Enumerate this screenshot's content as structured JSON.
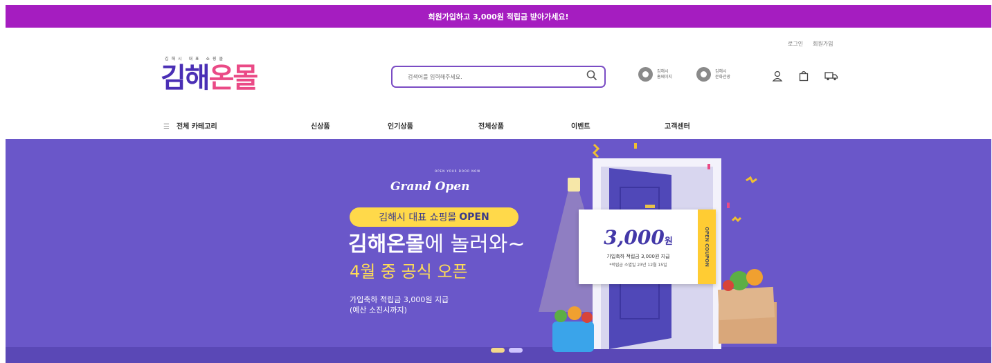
{
  "topbar": {
    "text": "회원가입하고 3,000원 적립금 받아가세요!"
  },
  "util": {
    "login": "로그인",
    "signup": "회원가입"
  },
  "logo": {
    "sub": "김해시 대표 쇼핑몰",
    "main_a": "김해",
    "main_b": "온몰"
  },
  "search": {
    "placeholder": "검색어를 입력해주세요."
  },
  "ext_links": [
    {
      "line1": "김해시",
      "line2": "홈페이지"
    },
    {
      "line1": "김해시",
      "line2": "문화관광"
    }
  ],
  "nav": {
    "all_categories": "전체 카테고리",
    "items": [
      "신상품",
      "인기상품",
      "전체상품",
      "이벤트",
      "고객센터"
    ]
  },
  "hero": {
    "arc_text": "OPEN YOUR DOOR NOW",
    "grand_open": "Grand Open",
    "pill_text": "김해시 대표 쇼핑몰",
    "pill_bold": "OPEN",
    "headline_bold": "김해온몰",
    "headline_rest": "에 놀러와~",
    "subline": "4월 중 공식 오픈",
    "desc1": "가입축하 적립금 3,000원 지급",
    "desc2": "(예산 소진시까지)",
    "coupon": {
      "amount": "3,000",
      "unit": "원",
      "line1": "가입축하 적립금 3,000원 지급",
      "line2": "*적립금 소멸일 23년 12월 15일",
      "side": "OPEN COUPON"
    }
  },
  "colors": {
    "topbar": "#a51dc0",
    "brand": "#4a2fb5",
    "hero_bg": "#6a57c9",
    "accent_yellow": "#ffd94a"
  }
}
